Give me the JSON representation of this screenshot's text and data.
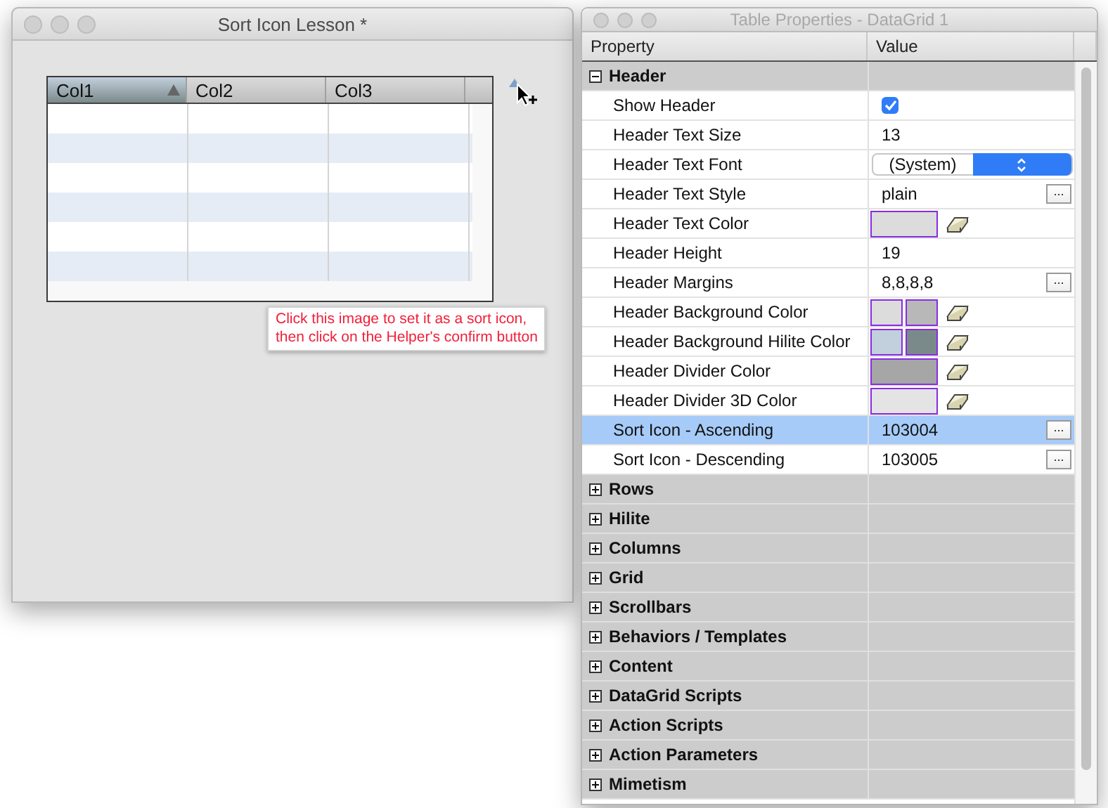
{
  "lesson_window": {
    "title": "Sort Icon Lesson *",
    "grid": {
      "columns": [
        {
          "label": "Col1",
          "selected": true
        },
        {
          "label": "Col2",
          "selected": false
        },
        {
          "label": "Col3",
          "selected": false
        }
      ]
    },
    "tooltip": {
      "lines": [
        "Click this image to set it as a sort icon,",
        "then click on the Helper's confirm button"
      ]
    }
  },
  "properties_window": {
    "title": "Table Properties - DataGrid 1",
    "columns": [
      "Property",
      "Value"
    ],
    "sections": [
      {
        "label": "Header",
        "expanded": true,
        "children": [
          {
            "label": "Show Header",
            "kind": "checkbox",
            "checked": true,
            "selected": false
          },
          {
            "label": "Header Text Size",
            "kind": "text",
            "value": "13",
            "selected": false
          },
          {
            "label": "Header Text Font",
            "kind": "popup",
            "value": "(System)",
            "selected": false
          },
          {
            "label": "Header Text Style",
            "kind": "text_button",
            "value": "plain",
            "button": "...",
            "selected": false
          },
          {
            "label": "Header Text Color",
            "kind": "colors",
            "swatches": [
              {
                "color": "#dcdcdc"
              }
            ],
            "selected": false
          },
          {
            "label": "Header Height",
            "kind": "text",
            "value": "19",
            "selected": false
          },
          {
            "label": "Header Margins",
            "kind": "text_button",
            "value": "8,8,8,8",
            "button": "...",
            "selected": false
          },
          {
            "label": "Header Background Color",
            "kind": "colors",
            "swatches": [
              {
                "color": "#dcdcdc"
              },
              {
                "color": "#b8b8b8"
              }
            ],
            "selected": false
          },
          {
            "label": "Header Background Hilite Color",
            "kind": "colors",
            "swatches": [
              {
                "color": "#c2cfdc"
              },
              {
                "color": "#7a8a8a"
              }
            ],
            "selected": false
          },
          {
            "label": "Header Divider Color",
            "kind": "colors",
            "swatches": [
              {
                "color": "#a6a6a6"
              }
            ],
            "selected": false
          },
          {
            "label": "Header Divider 3D Color",
            "kind": "colors",
            "swatches": [
              {
                "color": "#e4e4e4"
              }
            ],
            "selected": false
          },
          {
            "label": "Sort Icon - Ascending",
            "kind": "text_button",
            "value": "103004",
            "button": "...",
            "selected": true
          },
          {
            "label": "Sort Icon - Descending",
            "kind": "text_button",
            "value": "103005",
            "button": "...",
            "selected": false
          }
        ]
      },
      {
        "label": "Rows",
        "expanded": false
      },
      {
        "label": "Hilite",
        "expanded": false
      },
      {
        "label": "Columns",
        "expanded": false
      },
      {
        "label": "Grid",
        "expanded": false
      },
      {
        "label": "Scrollbars",
        "expanded": false
      },
      {
        "label": "Behaviors / Templates",
        "expanded": false
      },
      {
        "label": "Content",
        "expanded": false
      },
      {
        "label": "DataGrid Scripts",
        "expanded": false
      },
      {
        "label": "Action Scripts",
        "expanded": false
      },
      {
        "label": "Action Parameters",
        "expanded": false
      },
      {
        "label": "Mimetism",
        "expanded": false
      }
    ]
  }
}
